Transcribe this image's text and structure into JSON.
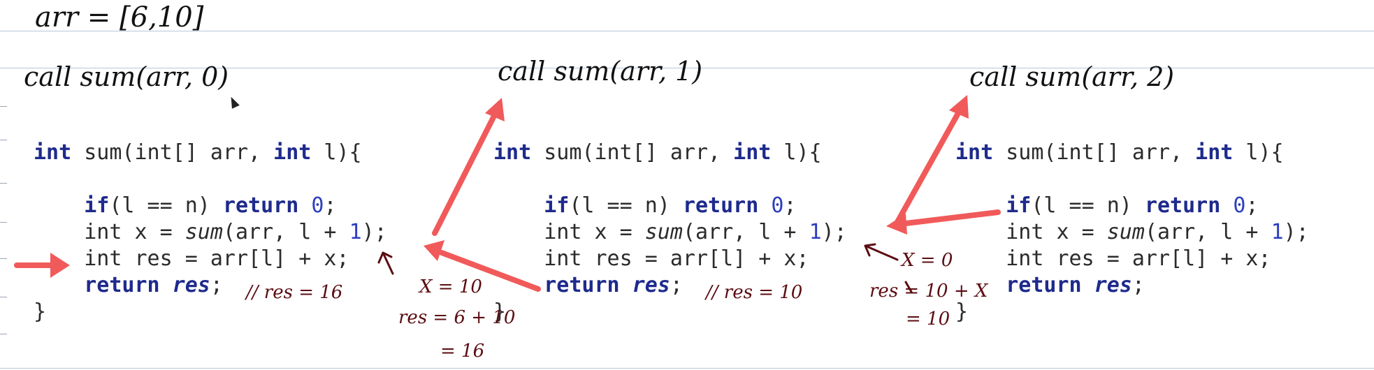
{
  "header_note": "arr = [6,10]",
  "calls": [
    "call sum(arr, 0)",
    "call sum(arr, 1)",
    "call sum(arr, 2)"
  ],
  "code": {
    "kw_int": "int",
    "sig_rest": " sum(int[] arr, ",
    "sig_param": "l){",
    "kw_if": "if",
    "cond": "(l == n) ",
    "kw_return": "return",
    "zero": "0",
    "semi": ";",
    "x_decl": "int x = ",
    "sum_call": "sum",
    "call_args": "(arr, l + ",
    "one": "1",
    "call_end": ");",
    "res_decl": "int res = arr[l] + x;",
    "res_var": "res",
    "close_brace": "}"
  },
  "notes": {
    "frame1_comment": "// res = 16",
    "frame2_comment": "// res = 10",
    "frame1_x": "X = 10",
    "frame1_res": "res = 6 + 10",
    "frame1_eq": "= 16",
    "frame2_x": "X = 0",
    "frame2_res": "res = 10 + X",
    "frame2_eq": "= 10"
  },
  "colors": {
    "arrow": "#f15a5a",
    "annotation": "#5b0d12",
    "keyword": "#1e2a8c",
    "rule": "#b9c7d9"
  }
}
